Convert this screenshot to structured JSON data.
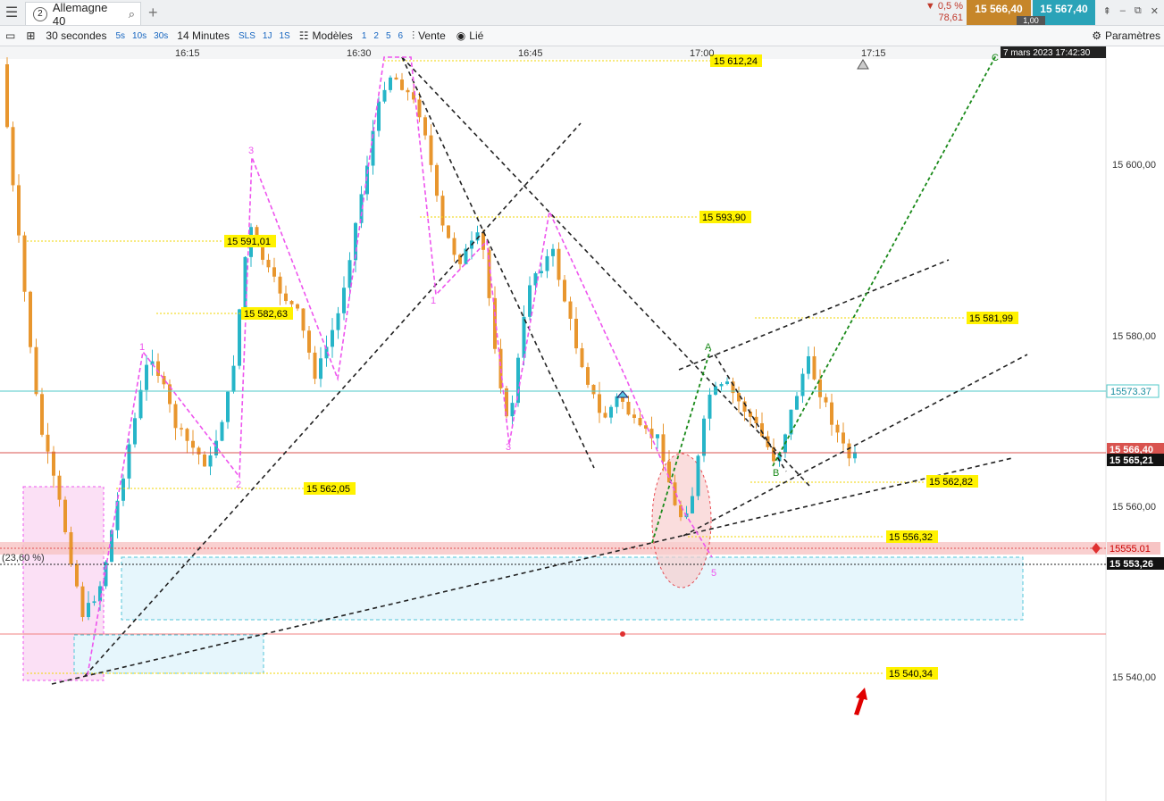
{
  "tabbar": {
    "menu_icon": "hamburger-icon",
    "tab_number": "2",
    "tab_label": "Allemagne 40",
    "search_icon": "search-icon",
    "add_tab": "+"
  },
  "quote": {
    "change_pct": "▼ 0,5 %",
    "change_abs": "78,61",
    "bid": "15 566,40",
    "ask": "15 567,40",
    "spread": "1,00"
  },
  "toolbar": {
    "interval": "30 secondes",
    "quick_intervals": [
      "5s",
      "10s",
      "30s"
    ],
    "range": "14 Minutes",
    "quick_ranges": [
      "SLS",
      "1J",
      "1S"
    ],
    "models_label": "Modèles",
    "model_counts": [
      "1",
      "2",
      "5",
      "6"
    ],
    "sell_label": "Vente",
    "linked_label": "Lié",
    "settings_label": "Paramètres"
  },
  "time_axis": {
    "labels": [
      "16:15",
      "16:30",
      "16:45",
      "17:00",
      "17:15"
    ],
    "current_datetime": "7 mars 2023 17:42:30"
  },
  "price_axis": {
    "labels": [
      "15 600,00",
      "15 580,00",
      "15 560,00",
      "15 540,00"
    ],
    "marker_cyan": "15573.37",
    "marker_red": "15 566,40",
    "marker_black": "15 565,21",
    "marker_pink": "15555.01",
    "marker_dotted": "15 553,26"
  },
  "annotations": {
    "levels": [
      "15 612,24",
      "15 593,90",
      "15 591,01",
      "15 582,63",
      "15 581,99",
      "15 562,82",
      "15 562,05",
      "15 556,32",
      "15 540,34"
    ],
    "fib_label": "(23,60 %)",
    "wave_labels": [
      "1",
      "2",
      "3",
      "1",
      "3",
      "5"
    ],
    "abc_labels": [
      "A",
      "B",
      "C"
    ]
  },
  "colors": {
    "bull": "#26b5c8",
    "bear": "#e8962e",
    "support_line": "#d9534f",
    "cyan_line": "#4fc9c9",
    "yellow_level": "#f2d600",
    "wave_pink": "#ee55ee",
    "trend_black": "#222222",
    "trend_green": "#1a8a1a"
  }
}
